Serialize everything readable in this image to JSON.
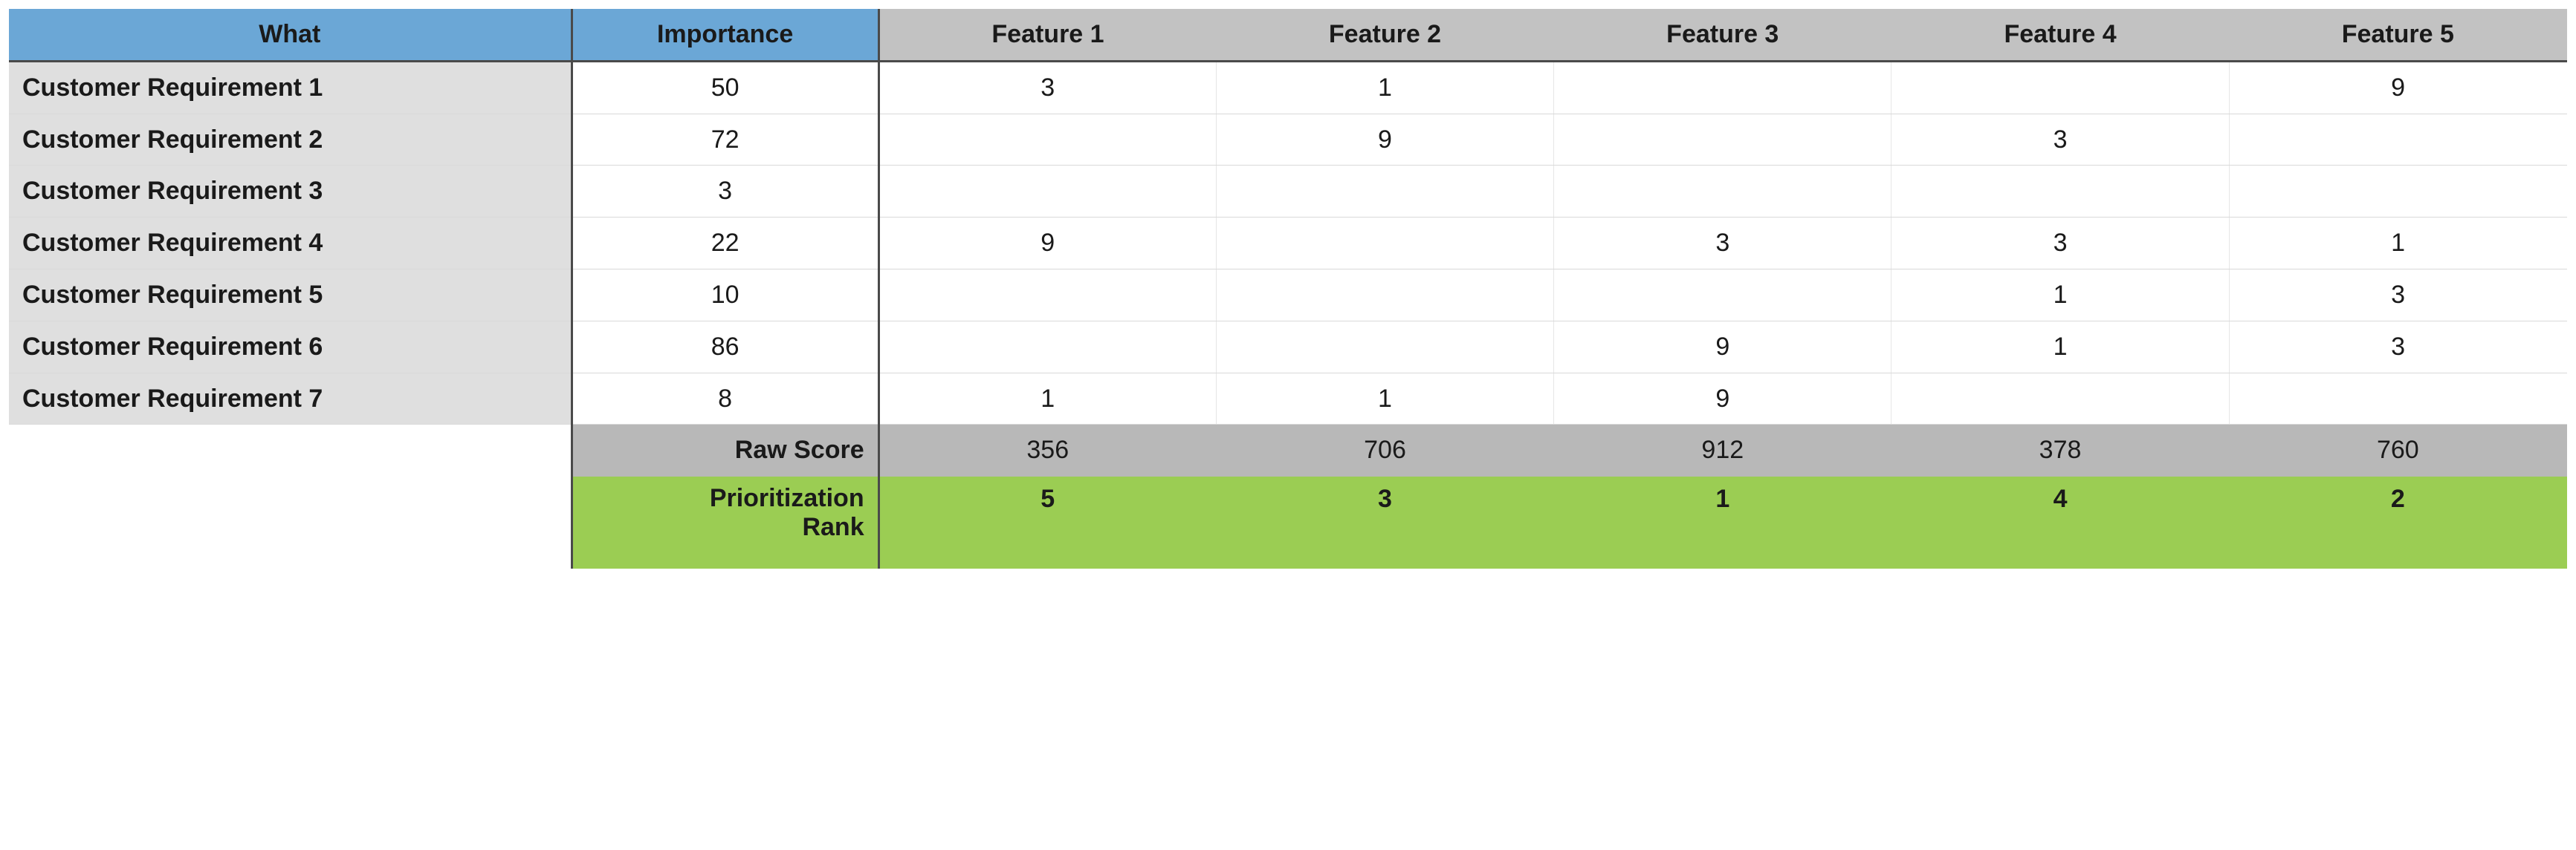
{
  "headers": {
    "what": "What",
    "importance": "Importance",
    "features": [
      "Feature 1",
      "Feature 2",
      "Feature 3",
      "Feature 4",
      "Feature 5"
    ]
  },
  "rows": [
    {
      "label": "Customer Requirement 1",
      "importance": "50",
      "f": [
        "3",
        "1",
        "",
        "",
        "9"
      ]
    },
    {
      "label": "Customer Requirement 2",
      "importance": "72",
      "f": [
        "",
        "9",
        "",
        "3",
        ""
      ]
    },
    {
      "label": "Customer Requirement 3",
      "importance": "3",
      "f": [
        "",
        "",
        "",
        "",
        ""
      ]
    },
    {
      "label": "Customer Requirement 4",
      "importance": "22",
      "f": [
        "9",
        "",
        "3",
        "3",
        "1"
      ]
    },
    {
      "label": "Customer Requirement 5",
      "importance": "10",
      "f": [
        "",
        "",
        "",
        "1",
        "3"
      ]
    },
    {
      "label": "Customer Requirement 6",
      "importance": "86",
      "f": [
        "",
        "",
        "9",
        "1",
        "3"
      ]
    },
    {
      "label": "Customer Requirement 7",
      "importance": "8",
      "f": [
        "1",
        "1",
        "9",
        "",
        ""
      ]
    }
  ],
  "summary": {
    "raw_label": "Raw Score",
    "raw": [
      "356",
      "706",
      "912",
      "378",
      "760"
    ],
    "rank_label": "Prioritization\nRank",
    "rank": [
      "5",
      "3",
      "1",
      "4",
      "2"
    ]
  },
  "chart_data": {
    "type": "table",
    "title": "House of Quality / QFD Matrix",
    "columns": [
      "What",
      "Importance",
      "Feature 1",
      "Feature 2",
      "Feature 3",
      "Feature 4",
      "Feature 5"
    ],
    "requirements": [
      {
        "name": "Customer Requirement 1",
        "importance": 50,
        "scores": [
          3,
          1,
          null,
          null,
          9
        ]
      },
      {
        "name": "Customer Requirement 2",
        "importance": 72,
        "scores": [
          null,
          9,
          null,
          3,
          null
        ]
      },
      {
        "name": "Customer Requirement 3",
        "importance": 3,
        "scores": [
          null,
          null,
          null,
          null,
          null
        ]
      },
      {
        "name": "Customer Requirement 4",
        "importance": 22,
        "scores": [
          9,
          null,
          3,
          3,
          1
        ]
      },
      {
        "name": "Customer Requirement 5",
        "importance": 10,
        "scores": [
          null,
          null,
          null,
          1,
          3
        ]
      },
      {
        "name": "Customer Requirement 6",
        "importance": 86,
        "scores": [
          null,
          null,
          9,
          1,
          3
        ]
      },
      {
        "name": "Customer Requirement 7",
        "importance": 8,
        "scores": [
          1,
          1,
          9,
          null,
          null
        ]
      }
    ],
    "raw_score": [
      356,
      706,
      912,
      378,
      760
    ],
    "prioritization_rank": [
      5,
      3,
      1,
      4,
      2
    ]
  }
}
